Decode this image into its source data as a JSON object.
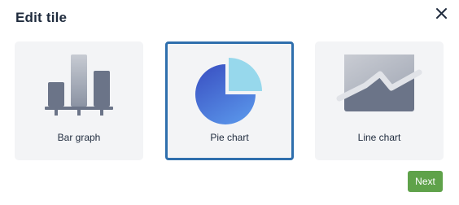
{
  "dialog": {
    "title": "Edit tile",
    "close_icon": "close-icon"
  },
  "tiles": [
    {
      "label": "Bar graph",
      "icon": "bar-graph-icon",
      "selected": false
    },
    {
      "label": "Pie chart",
      "icon": "pie-chart-icon",
      "selected": true
    },
    {
      "label": "Line chart",
      "icon": "line-chart-icon",
      "selected": false
    }
  ],
  "footer": {
    "next_label": "Next"
  },
  "colors": {
    "selected_border": "#2f6fad",
    "next_button": "#5fa24a",
    "tile_background": "#f3f4f6",
    "pie_gradient_start": "#3b53c4",
    "pie_gradient_end": "#5a96ea",
    "pie_slice": "#97d8ec"
  }
}
